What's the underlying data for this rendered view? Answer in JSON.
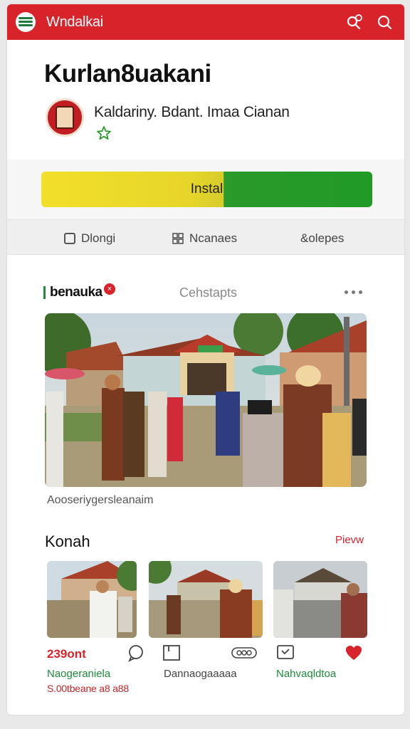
{
  "topbar": {
    "app_name": "Wndalkai",
    "icons": [
      "logo-icon",
      "refresh-search-icon",
      "search-icon"
    ]
  },
  "header": {
    "title": "Kurlan8uakani",
    "developer": "Kaldariny. Bdant. Imaa Cianan",
    "icons": [
      "developer-avatar",
      "star-icon"
    ]
  },
  "install": {
    "label": "Instal"
  },
  "tabs": [
    {
      "label": "Dlongi",
      "icon": "square-icon"
    },
    {
      "label": "Ncanaes",
      "icon": "grid-icon"
    },
    {
      "label": "&olepes",
      "icon": "link-icon"
    }
  ],
  "feed": {
    "label": "benauka",
    "badge": "×",
    "secondary_label": "Cehstapts",
    "more_icon": "more-dots-icon",
    "hero_caption": "Aooseriygersleanaim"
  },
  "section": {
    "title": "Konah",
    "link": "Pievw",
    "cards": [
      {
        "title": "Naogeraniela",
        "icon": "comment-icon"
      },
      {
        "title": "Dannaogaaaaa",
        "icon": "image-icon"
      },
      {
        "title": "Nahvaqldtoa",
        "icon": "chat-icon"
      }
    ],
    "stat": "239ont",
    "meta": "S.00tbeane a8 a88"
  },
  "colors": {
    "brand_red": "#d8232a",
    "brand_green": "#1e8a3b",
    "install_yellow": "#f2df2a",
    "install_green": "#219a27"
  }
}
